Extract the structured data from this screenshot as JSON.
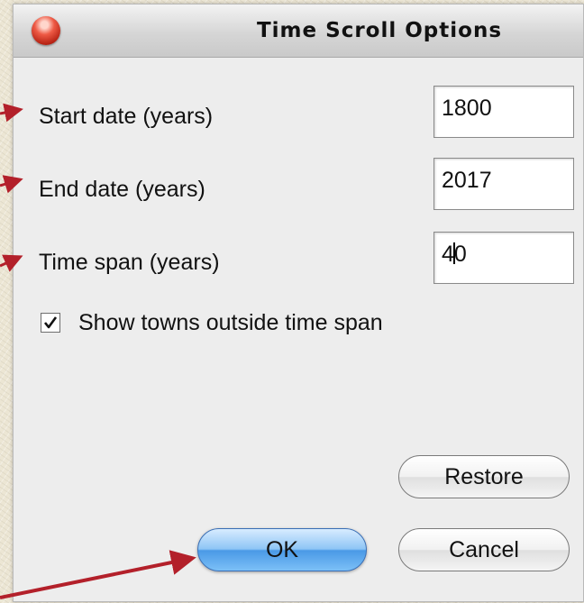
{
  "dialog": {
    "title": "Time Scroll Options",
    "fields": {
      "start_date": {
        "label": "Start date (years)",
        "value": "1800"
      },
      "end_date": {
        "label": "End date (years)",
        "value": "2017"
      },
      "time_span": {
        "label": "Time span (years)",
        "value_before_caret": "4",
        "value_after_caret": "0"
      }
    },
    "show_towns": {
      "label": "Show towns outside time span",
      "checked": true
    },
    "buttons": {
      "restore": "Restore",
      "ok": "OK",
      "cancel": "Cancel"
    }
  },
  "colors": {
    "annotation_arrow": "#b3202a",
    "default_button": "#4a99e6",
    "close_button": "#d83a28"
  }
}
